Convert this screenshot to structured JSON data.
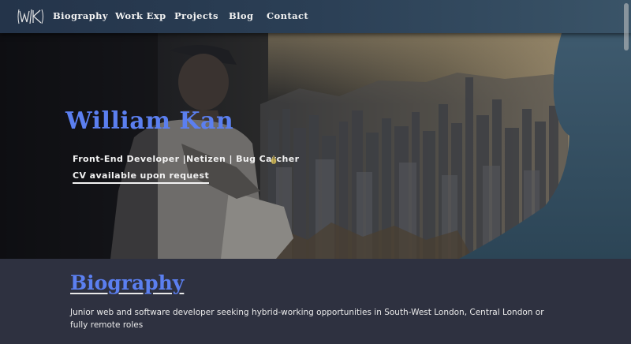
{
  "nav": {
    "logo_text": "W|K",
    "items": [
      {
        "label": "Biography"
      },
      {
        "label": "Work Exp"
      },
      {
        "label": "Projects"
      },
      {
        "label": "Blog"
      },
      {
        "label": "Contact"
      }
    ]
  },
  "hero": {
    "name": "William Kan",
    "roles": "Front-End Developer |Netizen | Bug Catcher",
    "bug_icon": "bug-icon",
    "cv_link": "CV available upon request"
  },
  "biography": {
    "title": "Biography",
    "text": "Junior web and software developer seeking hybrid-working opportunities in South-West London, Central London or fully remote roles"
  },
  "colors": {
    "accent": "#5b7ff0",
    "nav_bg": "#2b3f55",
    "page_bg": "#2e3140",
    "text": "#f2f2f2"
  }
}
